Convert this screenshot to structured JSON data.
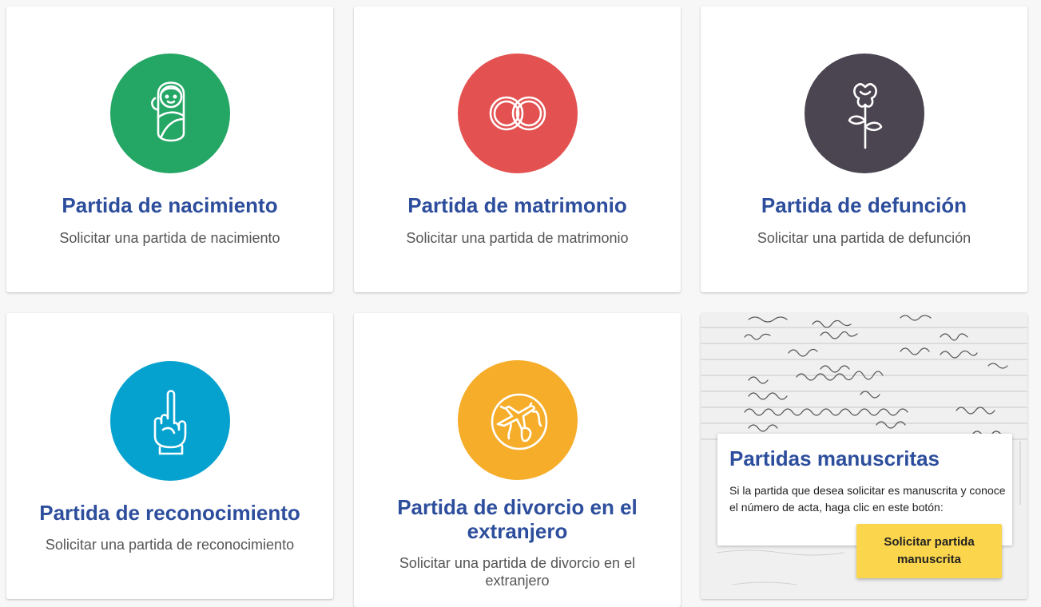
{
  "colors": {
    "title": "#2d4e9c",
    "birth": "#24a665",
    "marriage": "#e45151",
    "death": "#4a4550",
    "recognition": "#06a2cf",
    "divorce": "#f6ad2a",
    "button": "#fbd54b"
  },
  "cards": [
    {
      "icon": "swaddled-baby-icon",
      "title": "Partida de nacimiento",
      "description": "Solicitar una partida de nacimiento"
    },
    {
      "icon": "wedding-rings-icon",
      "title": "Partida de matrimonio",
      "description": "Solicitar una partida de matrimonio"
    },
    {
      "icon": "rose-icon",
      "title": "Partida de defunción",
      "description": "Solicitar una partida de defunción"
    },
    {
      "icon": "pointing-hand-icon",
      "title": "Partida de reconocimiento",
      "description": "Solicitar una partida de reconocimiento"
    },
    {
      "icon": "globe-airplane-icon",
      "title": "Partida de divorcio en el extranjero",
      "description": "Solicitar una partida de divorcio en el extranjero"
    }
  ],
  "manuscript": {
    "title": "Partidas manuscritas",
    "text": "Si la partida que desea solicitar es manuscrita y conoce el número de acta, haga clic en este botón:",
    "button_label": "Solicitar partida manuscrita"
  }
}
